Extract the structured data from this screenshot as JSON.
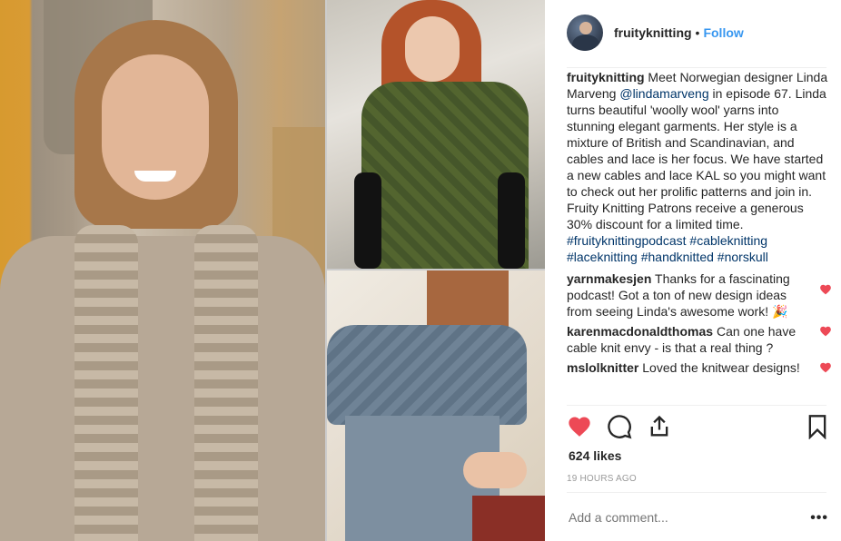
{
  "post": {
    "username": "fruityknitting",
    "follow_label": "Follow",
    "dot": "•"
  },
  "caption": {
    "username": "fruityknitting",
    "text_1": " Meet Norwegian designer Linda Marveng ",
    "mention": "@lindamarveng",
    "text_2": " in episode 67. Linda turns beautiful 'woolly wool' yarns into stunning elegant garments. Her style is a mixture of British and Scandinavian, and cables and lace is her focus. We have started a new cables and lace KAL so you might want to check out her prolific patterns and join in. Fruity Knitting Patrons receive a generous 30% discount for a limited time. ",
    "hashtags": [
      "#fruityknittingpodcast",
      "#cableknitting",
      "#laceknitting",
      "#handknitted",
      "#norskull"
    ]
  },
  "comments": [
    {
      "user": "yarnmakesjen",
      "text": " Thanks for a fascinating podcast! Got a ton of new design ideas from seeing Linda's awesome work! 🎉"
    },
    {
      "user": "karenmacdonaldthomas",
      "text": " Can one have cable knit envy - is that a real thing ?"
    },
    {
      "user": "mslolknitter",
      "text": " Loved the knitwear designs!"
    }
  ],
  "likes": "624 likes",
  "timestamp": "19 HOURS AGO",
  "comment_placeholder": "Add a comment...",
  "more_label": "•••",
  "colors": {
    "accent": "#3897f0",
    "heart": "#ed4956",
    "link": "#003569"
  },
  "icons": [
    "heart-icon",
    "comment-icon",
    "share-icon",
    "bookmark-icon",
    "more-icon"
  ]
}
